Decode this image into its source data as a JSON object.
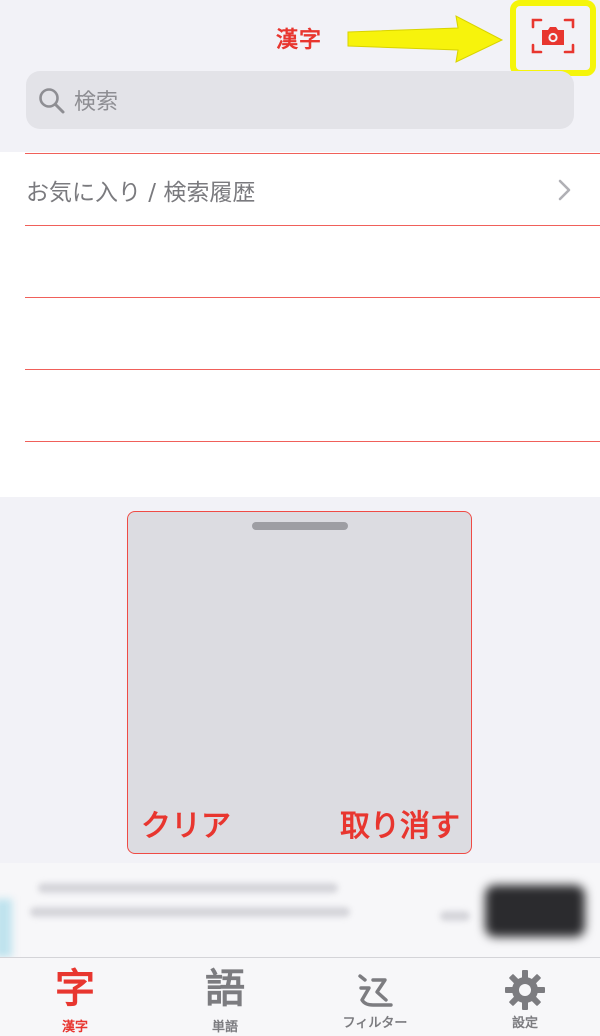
{
  "header": {
    "title": "漢字",
    "camera_icon": "camera-scan-icon"
  },
  "annotation": {
    "arrow_icon": "yellow-arrow-icon",
    "highlight_color": "#f5f50a"
  },
  "search": {
    "placeholder": "検索",
    "icon": "search-icon"
  },
  "list": {
    "items": [
      {
        "label": "お気に入り / 検索履歴",
        "icon": "chevron-right-icon"
      }
    ]
  },
  "pad": {
    "clear_label": "クリア",
    "undo_label": "取り消す"
  },
  "tabbar": {
    "tabs": [
      {
        "glyph": "字",
        "label": "漢字",
        "active": true
      },
      {
        "glyph": "語",
        "label": "単語",
        "active": false
      },
      {
        "glyph": "",
        "label": "フィルター",
        "icon": "filter-radical-icon",
        "active": false
      },
      {
        "glyph": "",
        "label": "設定",
        "icon": "gear-icon",
        "active": false
      }
    ]
  },
  "colors": {
    "accent": "#e8362f",
    "background": "#f2f2f7",
    "inactive": "#7c7c80"
  }
}
